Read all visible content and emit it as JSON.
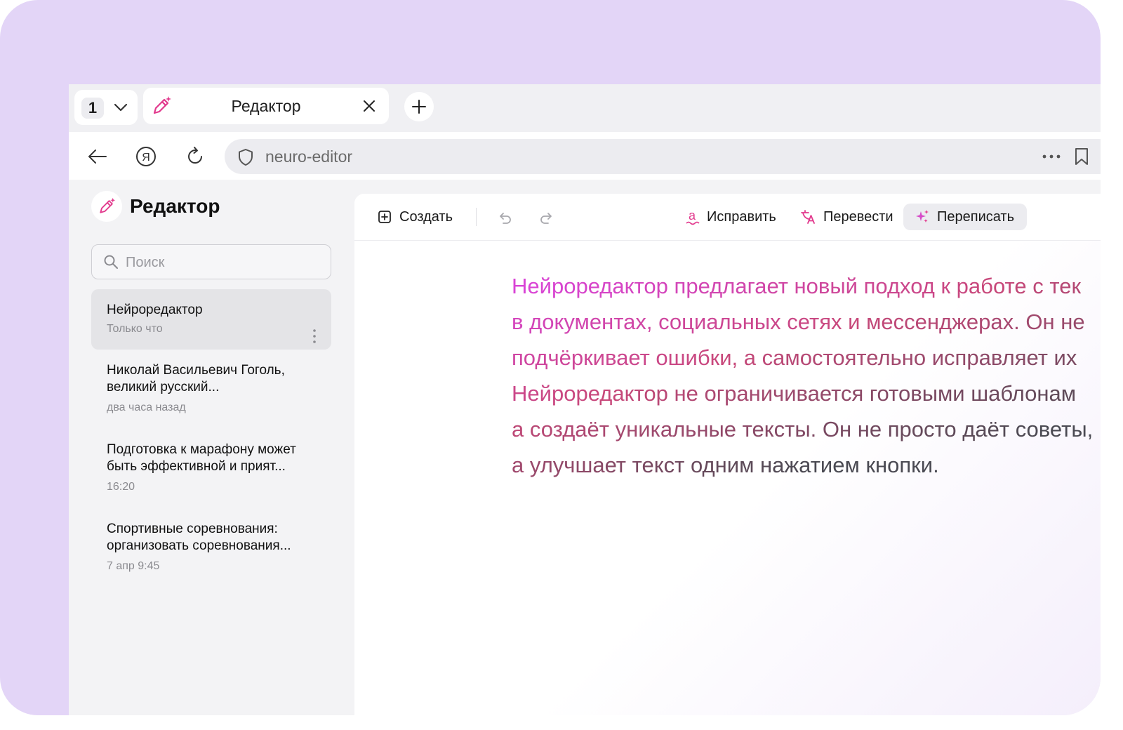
{
  "browser": {
    "tab_count": "1",
    "tab": {
      "title": "Редактор",
      "icon": "magic-pen-icon"
    },
    "address": "neuro-editor"
  },
  "sidebar": {
    "title": "Редактор",
    "search_placeholder": "Поиск",
    "documents": [
      {
        "title": "Нейроредактор",
        "time": "Только что",
        "active": true
      },
      {
        "title": "Николай Васильевич Гоголь, великий русский...",
        "time": "два часа назад"
      },
      {
        "title": "Подготовка к марафону может быть эффективной и прият...",
        "time": "16:20"
      },
      {
        "title": "Спортивные соревнования: организовать соревнования...",
        "time": "7 апр 9:45"
      }
    ]
  },
  "toolbar": {
    "create_label": "Создать",
    "fix_label": "Исправить",
    "translate_label": "Перевести",
    "rewrite_label": "Переписать"
  },
  "editor": {
    "lines": [
      "Нейроредактор предлагает новый подход к работе с тек",
      "в документах, социальных сетях и мессенджерах. Он не",
      "подчёркивает ошибки, а самостоятельно исправляет их",
      "Нейроредактор не ограничивается готовыми шаблонам",
      "а создаёт уникальные тексты. Он не просто даёт советы,",
      "а улучшает текст одним нажатием кнопки."
    ]
  },
  "colors": {
    "frame_background": "#e3d5f7",
    "accent_pink": "#e2398d",
    "text_gradient_start": "#d944d6",
    "text_gradient_mid": "#c8487a",
    "text_gradient_end": "#4a4a52"
  }
}
